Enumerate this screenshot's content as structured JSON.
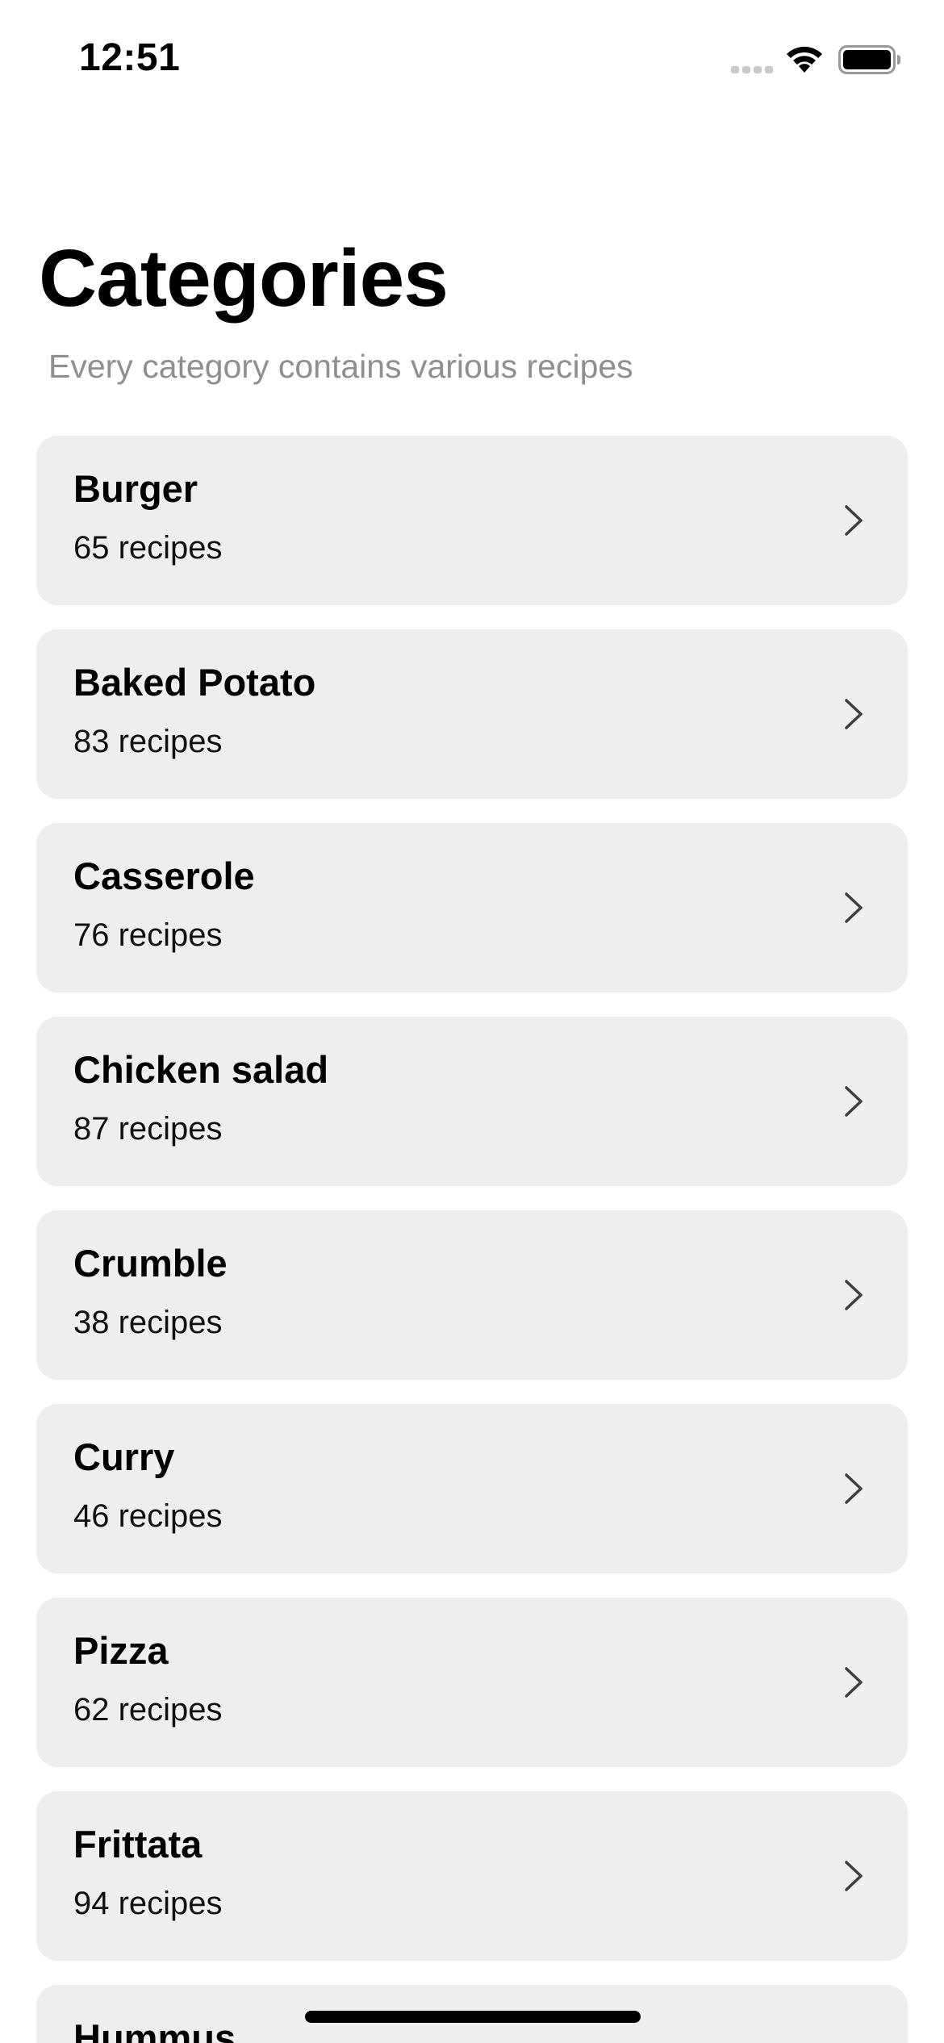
{
  "status_bar": {
    "time": "12:51"
  },
  "header": {
    "title": "Categories",
    "subtitle": "Every category contains various recipes"
  },
  "categories": [
    {
      "name": "Burger",
      "count": "65 recipes"
    },
    {
      "name": "Baked Potato",
      "count": "83 recipes"
    },
    {
      "name": "Casserole",
      "count": "76 recipes"
    },
    {
      "name": "Chicken salad",
      "count": "87 recipes"
    },
    {
      "name": "Crumble",
      "count": "38 recipes"
    },
    {
      "name": "Curry",
      "count": "46 recipes"
    },
    {
      "name": "Pizza",
      "count": "62 recipes"
    },
    {
      "name": "Frittata",
      "count": "94 recipes"
    },
    {
      "name": "Hummus",
      "count": ""
    }
  ],
  "icons": {
    "row_chevron": "chevron-right-icon",
    "signal": "cellular-signal-icon",
    "wifi": "wifi-icon",
    "battery": "battery-icon"
  },
  "colors": {
    "card_background": "#eeeeee",
    "subtitle_text": "#8e8e93",
    "chevron": "#3c3c43"
  }
}
